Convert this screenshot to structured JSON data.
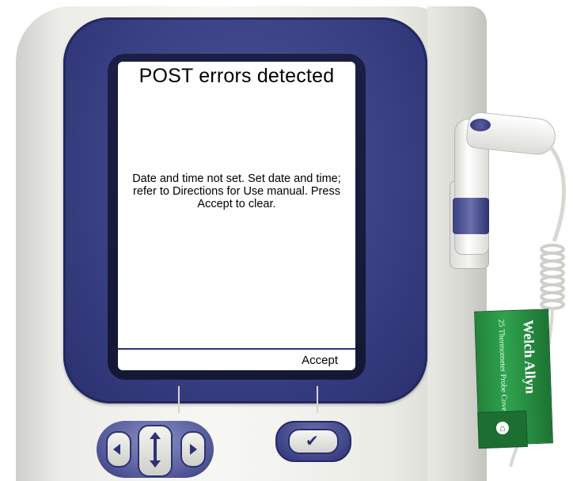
{
  "screen": {
    "title": "POST errors detected",
    "message": "Date and time not set. Set date and time; refer to Directions for Use manual. Press Accept to clear.",
    "softkey_label": "Accept"
  },
  "probe_covers": {
    "brand": "Welch Allyn",
    "label": "25 Thermometer Probe Covers"
  },
  "colors": {
    "bezel": "#3a4185",
    "screen_bg": "#ffffff",
    "covers_box": "#2fa34d"
  },
  "icons": {
    "nav_left": "chevron-left-icon",
    "nav_right": "chevron-right-icon",
    "nav_center": "up-down-icon",
    "check": "check-icon"
  }
}
